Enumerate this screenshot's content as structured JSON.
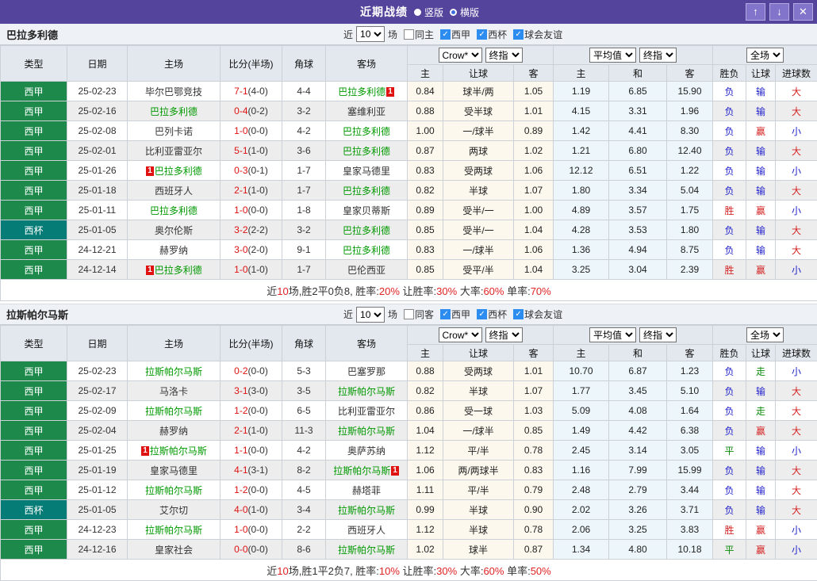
{
  "titlebar": {
    "title": "近期战绩",
    "view_options": [
      {
        "label": "竖版",
        "selected": true
      },
      {
        "label": "横版",
        "selected": false
      }
    ],
    "buttons": {
      "up": "↑",
      "down": "↓",
      "close": "✕"
    }
  },
  "table_header": {
    "type": "类型",
    "date": "日期",
    "home": "主场",
    "score": "比分(半场)",
    "corner": "角球",
    "away": "客场",
    "selects": {
      "bookmaker": "Crow*",
      "final1": "终指",
      "average": "平均值",
      "final2": "终指",
      "scope": "全场"
    },
    "sub": {
      "h": "主",
      "handicap": "让球",
      "a": "客",
      "avg_h": "主",
      "avg_d": "和",
      "avg_a": "客",
      "wdl": "胜负",
      "cover": "让球",
      "goals": "进球数"
    }
  },
  "colors": {
    "titlebar_purple": "#54449c",
    "liga_green": "#1d8a4b",
    "cup_teal": "#067c76",
    "focus_team_green": "#009900",
    "score_red": "#e01111",
    "win_red": "#d42222",
    "lose_blue": "#2222cc",
    "draw_green": "#0c8a0c",
    "odds_cream": "#fdf8ee",
    "avg_blue": "#edf6fb"
  },
  "sections": [
    {
      "team": "巴拉多利德",
      "filter": {
        "prefix": "近",
        "count": "10",
        "suffix": "场",
        "same": {
          "label": "同主",
          "checked": false
        },
        "leagues": [
          {
            "label": "西甲",
            "checked": true
          },
          {
            "label": "西杯",
            "checked": true
          },
          {
            "label": "球会友谊",
            "checked": true
          }
        ]
      },
      "rows": [
        {
          "type": "西甲",
          "type_style": "liga",
          "date": "25-02-23",
          "home": "毕尔巴鄂竞技",
          "home_focus": false,
          "home_badge": null,
          "score": "7-1",
          "half": "(4-0)",
          "corner": "4-4",
          "away": "巴拉多利德",
          "away_focus": true,
          "away_badge": "1",
          "odds": [
            "0.84",
            "球半/两",
            "1.05"
          ],
          "avg": [
            "1.19",
            "6.85",
            "15.90"
          ],
          "results": [
            [
              "负",
              "b"
            ],
            [
              "输",
              "b"
            ],
            [
              "大",
              "r"
            ]
          ]
        },
        {
          "type": "西甲",
          "type_style": "liga",
          "date": "25-02-16",
          "home": "巴拉多利德",
          "home_focus": true,
          "home_badge": null,
          "score": "0-4",
          "half": "(0-2)",
          "corner": "3-2",
          "away": "塞维利亚",
          "away_focus": false,
          "away_badge": null,
          "odds": [
            "0.88",
            "受半球",
            "1.01"
          ],
          "avg": [
            "4.15",
            "3.31",
            "1.96"
          ],
          "results": [
            [
              "负",
              "b"
            ],
            [
              "输",
              "b"
            ],
            [
              "大",
              "r"
            ]
          ]
        },
        {
          "type": "西甲",
          "type_style": "liga",
          "date": "25-02-08",
          "home": "巴列卡诺",
          "home_focus": false,
          "home_badge": null,
          "score": "1-0",
          "half": "(0-0)",
          "corner": "4-2",
          "away": "巴拉多利德",
          "away_focus": true,
          "away_badge": null,
          "odds": [
            "1.00",
            "一/球半",
            "0.89"
          ],
          "avg": [
            "1.42",
            "4.41",
            "8.30"
          ],
          "results": [
            [
              "负",
              "b"
            ],
            [
              "赢",
              "r"
            ],
            [
              "小",
              "b"
            ]
          ]
        },
        {
          "type": "西甲",
          "type_style": "liga",
          "date": "25-02-01",
          "home": "比利亚雷亚尔",
          "home_focus": false,
          "home_badge": null,
          "score": "5-1",
          "half": "(1-0)",
          "corner": "3-6",
          "away": "巴拉多利德",
          "away_focus": true,
          "away_badge": null,
          "odds": [
            "0.87",
            "两球",
            "1.02"
          ],
          "avg": [
            "1.21",
            "6.80",
            "12.40"
          ],
          "results": [
            [
              "负",
              "b"
            ],
            [
              "输",
              "b"
            ],
            [
              "大",
              "r"
            ]
          ]
        },
        {
          "type": "西甲",
          "type_style": "liga",
          "date": "25-01-26",
          "home": "巴拉多利德",
          "home_focus": true,
          "home_badge": "1",
          "score": "0-3",
          "half": "(0-1)",
          "corner": "1-7",
          "away": "皇家马德里",
          "away_focus": false,
          "away_badge": null,
          "odds": [
            "0.83",
            "受两球",
            "1.06"
          ],
          "avg": [
            "12.12",
            "6.51",
            "1.22"
          ],
          "results": [
            [
              "负",
              "b"
            ],
            [
              "输",
              "b"
            ],
            [
              "小",
              "b"
            ]
          ]
        },
        {
          "type": "西甲",
          "type_style": "liga",
          "date": "25-01-18",
          "home": "西班牙人",
          "home_focus": false,
          "home_badge": null,
          "score": "2-1",
          "half": "(1-0)",
          "corner": "1-7",
          "away": "巴拉多利德",
          "away_focus": true,
          "away_badge": null,
          "odds": [
            "0.82",
            "半球",
            "1.07"
          ],
          "avg": [
            "1.80",
            "3.34",
            "5.04"
          ],
          "results": [
            [
              "负",
              "b"
            ],
            [
              "输",
              "b"
            ],
            [
              "大",
              "r"
            ]
          ]
        },
        {
          "type": "西甲",
          "type_style": "liga",
          "date": "25-01-11",
          "home": "巴拉多利德",
          "home_focus": true,
          "home_badge": null,
          "score": "1-0",
          "half": "(0-0)",
          "corner": "1-8",
          "away": "皇家贝蒂斯",
          "away_focus": false,
          "away_badge": null,
          "odds": [
            "0.89",
            "受半/一",
            "1.00"
          ],
          "avg": [
            "4.89",
            "3.57",
            "1.75"
          ],
          "results": [
            [
              "胜",
              "r"
            ],
            [
              "赢",
              "r"
            ],
            [
              "小",
              "b"
            ]
          ]
        },
        {
          "type": "西杯",
          "type_style": "cup",
          "date": "25-01-05",
          "home": "奥尔伦斯",
          "home_focus": false,
          "home_badge": null,
          "score": "3-2",
          "half": "(2-2)",
          "corner": "3-2",
          "away": "巴拉多利德",
          "away_focus": true,
          "away_badge": null,
          "odds": [
            "0.85",
            "受半/一",
            "1.04"
          ],
          "avg": [
            "4.28",
            "3.53",
            "1.80"
          ],
          "results": [
            [
              "负",
              "b"
            ],
            [
              "输",
              "b"
            ],
            [
              "大",
              "r"
            ]
          ]
        },
        {
          "type": "西甲",
          "type_style": "liga",
          "date": "24-12-21",
          "home": "赫罗纳",
          "home_focus": false,
          "home_badge": null,
          "score": "3-0",
          "half": "(2-0)",
          "corner": "9-1",
          "away": "巴拉多利德",
          "away_focus": true,
          "away_badge": null,
          "odds": [
            "0.83",
            "一/球半",
            "1.06"
          ],
          "avg": [
            "1.36",
            "4.94",
            "8.75"
          ],
          "results": [
            [
              "负",
              "b"
            ],
            [
              "输",
              "b"
            ],
            [
              "大",
              "r"
            ]
          ]
        },
        {
          "type": "西甲",
          "type_style": "liga",
          "date": "24-12-14",
          "home": "巴拉多利德",
          "home_focus": true,
          "home_badge": "1",
          "score": "1-0",
          "half": "(1-0)",
          "corner": "1-7",
          "away": "巴伦西亚",
          "away_focus": false,
          "away_badge": null,
          "odds": [
            "0.85",
            "受平/半",
            "1.04"
          ],
          "avg": [
            "3.25",
            "3.04",
            "2.39"
          ],
          "results": [
            [
              "胜",
              "r"
            ],
            [
              "赢",
              "r"
            ],
            [
              "小",
              "b"
            ]
          ]
        }
      ],
      "summary": [
        [
          "近",
          "k"
        ],
        [
          "10",
          "r"
        ],
        [
          "场,胜2平0负8, 胜率:",
          "k"
        ],
        [
          "20%",
          "r"
        ],
        [
          " 让胜率:",
          "k"
        ],
        [
          "30%",
          "r"
        ],
        [
          " 大率:",
          "k"
        ],
        [
          "60%",
          "r"
        ],
        [
          " 单率:",
          "k"
        ],
        [
          "70%",
          "r"
        ]
      ]
    },
    {
      "team": "拉斯帕尔马斯",
      "filter": {
        "prefix": "近",
        "count": "10",
        "suffix": "场",
        "same": {
          "label": "同客",
          "checked": false
        },
        "leagues": [
          {
            "label": "西甲",
            "checked": true
          },
          {
            "label": "西杯",
            "checked": true
          },
          {
            "label": "球会友谊",
            "checked": true
          }
        ]
      },
      "rows": [
        {
          "type": "西甲",
          "type_style": "liga",
          "date": "25-02-23",
          "home": "拉斯帕尔马斯",
          "home_focus": true,
          "home_badge": null,
          "score": "0-2",
          "half": "(0-0)",
          "corner": "5-3",
          "away": "巴塞罗那",
          "away_focus": false,
          "away_badge": null,
          "odds": [
            "0.88",
            "受两球",
            "1.01"
          ],
          "avg": [
            "10.70",
            "6.87",
            "1.23"
          ],
          "results": [
            [
              "负",
              "b"
            ],
            [
              "走",
              "g"
            ],
            [
              "小",
              "b"
            ]
          ]
        },
        {
          "type": "西甲",
          "type_style": "liga",
          "date": "25-02-17",
          "home": "马洛卡",
          "home_focus": false,
          "home_badge": null,
          "score": "3-1",
          "half": "(3-0)",
          "corner": "3-5",
          "away": "拉斯帕尔马斯",
          "away_focus": true,
          "away_badge": null,
          "odds": [
            "0.82",
            "半球",
            "1.07"
          ],
          "avg": [
            "1.77",
            "3.45",
            "5.10"
          ],
          "results": [
            [
              "负",
              "b"
            ],
            [
              "输",
              "b"
            ],
            [
              "大",
              "r"
            ]
          ]
        },
        {
          "type": "西甲",
          "type_style": "liga",
          "date": "25-02-09",
          "home": "拉斯帕尔马斯",
          "home_focus": true,
          "home_badge": null,
          "score": "1-2",
          "half": "(0-0)",
          "corner": "6-5",
          "away": "比利亚雷亚尔",
          "away_focus": false,
          "away_badge": null,
          "odds": [
            "0.86",
            "受一球",
            "1.03"
          ],
          "avg": [
            "5.09",
            "4.08",
            "1.64"
          ],
          "results": [
            [
              "负",
              "b"
            ],
            [
              "走",
              "g"
            ],
            [
              "大",
              "r"
            ]
          ]
        },
        {
          "type": "西甲",
          "type_style": "liga",
          "date": "25-02-04",
          "home": "赫罗纳",
          "home_focus": false,
          "home_badge": null,
          "score": "2-1",
          "half": "(1-0)",
          "corner": "11-3",
          "away": "拉斯帕尔马斯",
          "away_focus": true,
          "away_badge": null,
          "odds": [
            "1.04",
            "一/球半",
            "0.85"
          ],
          "avg": [
            "1.49",
            "4.42",
            "6.38"
          ],
          "results": [
            [
              "负",
              "b"
            ],
            [
              "赢",
              "r"
            ],
            [
              "大",
              "r"
            ]
          ]
        },
        {
          "type": "西甲",
          "type_style": "liga",
          "date": "25-01-25",
          "home": "拉斯帕尔马斯",
          "home_focus": true,
          "home_badge": "1",
          "score": "1-1",
          "half": "(0-0)",
          "corner": "4-2",
          "away": "奥萨苏纳",
          "away_focus": false,
          "away_badge": null,
          "odds": [
            "1.12",
            "平/半",
            "0.78"
          ],
          "avg": [
            "2.45",
            "3.14",
            "3.05"
          ],
          "results": [
            [
              "平",
              "g"
            ],
            [
              "输",
              "b"
            ],
            [
              "小",
              "b"
            ]
          ]
        },
        {
          "type": "西甲",
          "type_style": "liga",
          "date": "25-01-19",
          "home": "皇家马德里",
          "home_focus": false,
          "home_badge": null,
          "score": "4-1",
          "half": "(3-1)",
          "corner": "8-2",
          "away": "拉斯帕尔马斯",
          "away_focus": true,
          "away_badge": "1",
          "odds": [
            "1.06",
            "两/两球半",
            "0.83"
          ],
          "avg": [
            "1.16",
            "7.99",
            "15.99"
          ],
          "results": [
            [
              "负",
              "b"
            ],
            [
              "输",
              "b"
            ],
            [
              "大",
              "r"
            ]
          ]
        },
        {
          "type": "西甲",
          "type_style": "liga",
          "date": "25-01-12",
          "home": "拉斯帕尔马斯",
          "home_focus": true,
          "home_badge": null,
          "score": "1-2",
          "half": "(0-0)",
          "corner": "4-5",
          "away": "赫塔菲",
          "away_focus": false,
          "away_badge": null,
          "odds": [
            "1.11",
            "平/半",
            "0.79"
          ],
          "avg": [
            "2.48",
            "2.79",
            "3.44"
          ],
          "results": [
            [
              "负",
              "b"
            ],
            [
              "输",
              "b"
            ],
            [
              "大",
              "r"
            ]
          ]
        },
        {
          "type": "西杯",
          "type_style": "cup",
          "date": "25-01-05",
          "home": "艾尔切",
          "home_focus": false,
          "home_badge": null,
          "score": "4-0",
          "half": "(1-0)",
          "corner": "3-4",
          "away": "拉斯帕尔马斯",
          "away_focus": true,
          "away_badge": null,
          "odds": [
            "0.99",
            "半球",
            "0.90"
          ],
          "avg": [
            "2.02",
            "3.26",
            "3.71"
          ],
          "results": [
            [
              "负",
              "b"
            ],
            [
              "输",
              "b"
            ],
            [
              "大",
              "r"
            ]
          ]
        },
        {
          "type": "西甲",
          "type_style": "liga",
          "date": "24-12-23",
          "home": "拉斯帕尔马斯",
          "home_focus": true,
          "home_badge": null,
          "score": "1-0",
          "half": "(0-0)",
          "corner": "2-2",
          "away": "西班牙人",
          "away_focus": false,
          "away_badge": null,
          "odds": [
            "1.12",
            "半球",
            "0.78"
          ],
          "avg": [
            "2.06",
            "3.25",
            "3.83"
          ],
          "results": [
            [
              "胜",
              "r"
            ],
            [
              "赢",
              "r"
            ],
            [
              "小",
              "b"
            ]
          ]
        },
        {
          "type": "西甲",
          "type_style": "liga",
          "date": "24-12-16",
          "home": "皇家社会",
          "home_focus": false,
          "home_badge": null,
          "score": "0-0",
          "half": "(0-0)",
          "corner": "8-6",
          "away": "拉斯帕尔马斯",
          "away_focus": true,
          "away_badge": null,
          "odds": [
            "1.02",
            "球半",
            "0.87"
          ],
          "avg": [
            "1.34",
            "4.80",
            "10.18"
          ],
          "results": [
            [
              "平",
              "g"
            ],
            [
              "赢",
              "r"
            ],
            [
              "小",
              "b"
            ]
          ]
        }
      ],
      "summary": [
        [
          "近",
          "k"
        ],
        [
          "10",
          "r"
        ],
        [
          "场,胜1平2负7, 胜率:",
          "k"
        ],
        [
          "10%",
          "r"
        ],
        [
          " 让胜率:",
          "k"
        ],
        [
          "30%",
          "r"
        ],
        [
          " 大率:",
          "k"
        ],
        [
          "60%",
          "r"
        ],
        [
          " 单率:",
          "k"
        ],
        [
          "50%",
          "r"
        ]
      ]
    }
  ]
}
